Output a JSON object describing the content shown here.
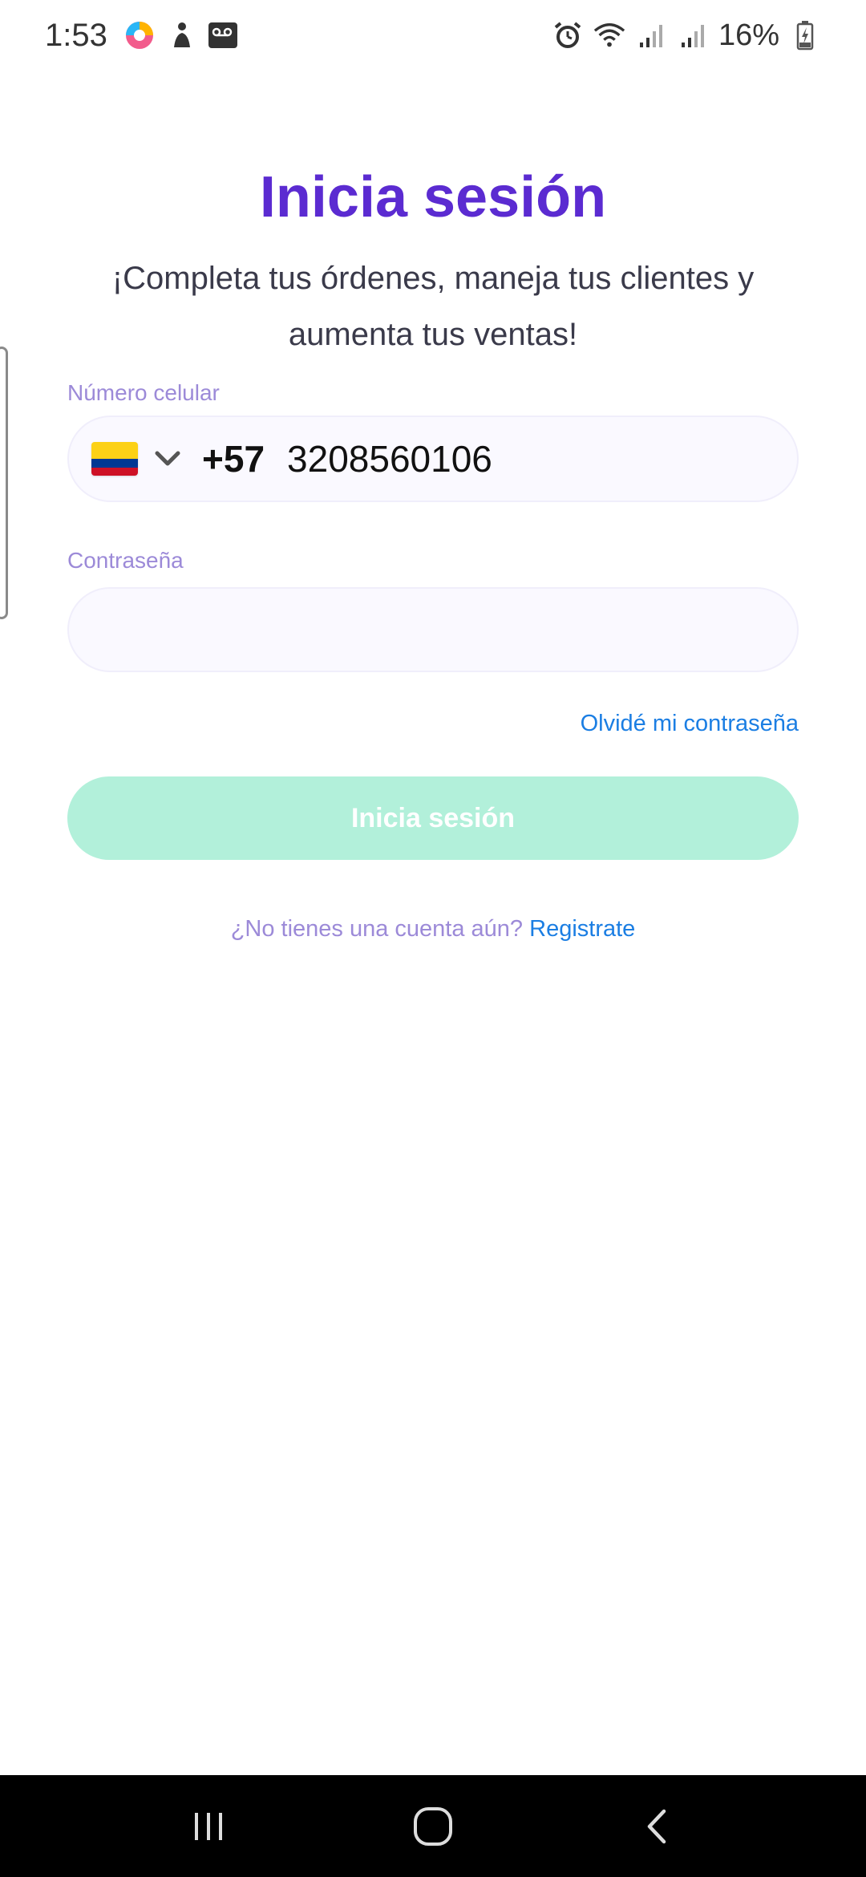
{
  "status_bar": {
    "time": "1:53",
    "battery_percent": "16%",
    "icons_left": [
      "app-circle-icon",
      "accessibility-icon",
      "voicemail-icon"
    ],
    "icons_right": [
      "alarm-icon",
      "wifi-icon",
      "signal-icon",
      "signal-icon",
      "battery-charging-icon"
    ]
  },
  "login": {
    "title": "Inicia sesión",
    "subtitle": "¡Completa tus órdenes, maneja tus clientes y aumenta tus ventas!",
    "phone_label": "Número celular",
    "country_flag": "colombia-flag",
    "dial_code": "+57",
    "phone_value": "3208560106",
    "password_label": "Contraseña",
    "password_value": "",
    "forgot_label": "Olvidé mi contraseña",
    "submit_label": "Inicia sesión",
    "no_account_text": "¿No tienes una cuenta aún?",
    "register_label": "Registrate"
  },
  "colors": {
    "title": "#5b2bd1",
    "link": "#1b7ee3",
    "label": "#9c8ad8",
    "button_disabled": "#b2f0da"
  },
  "nav_bar": {
    "buttons": [
      "recent-apps-icon",
      "home-icon",
      "back-icon"
    ]
  }
}
